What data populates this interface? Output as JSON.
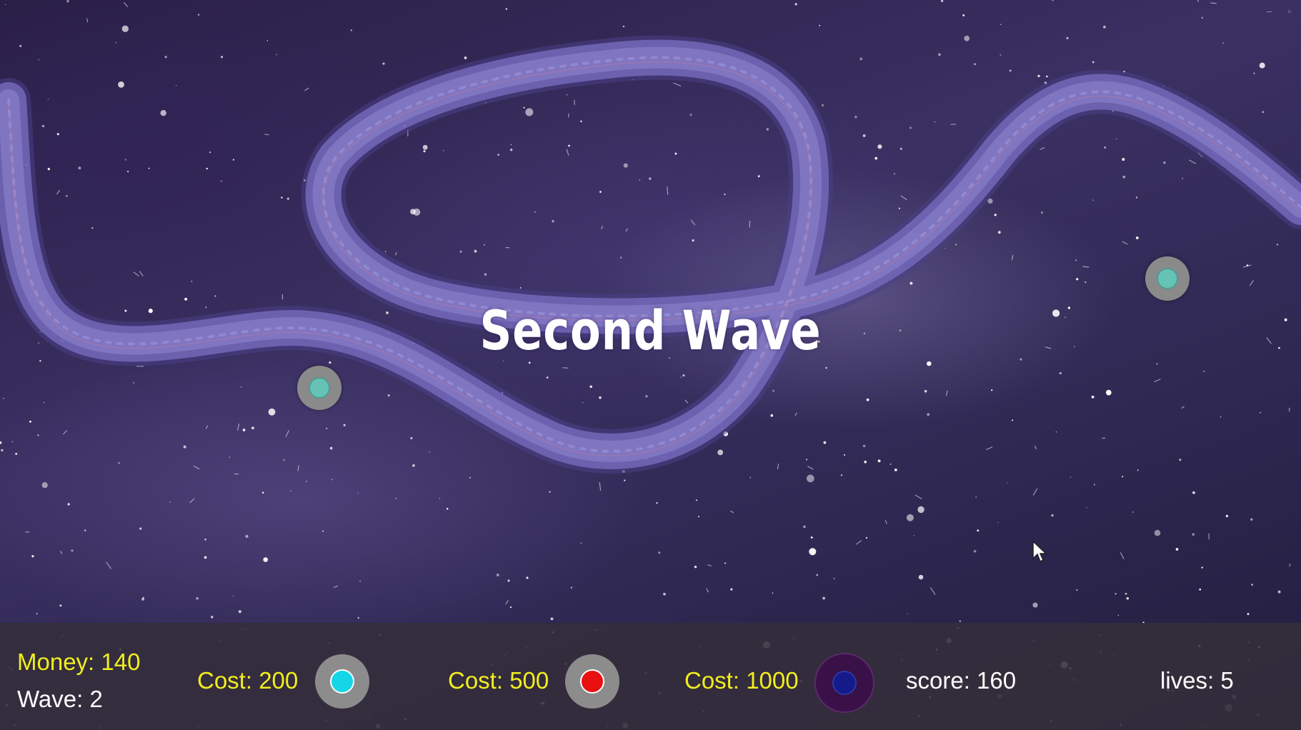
{
  "colors": {
    "hud_money_text": "#f2ee1e",
    "hud_white_text": "#ffffff",
    "tower_base": "#8a8a8a",
    "tower1_core": "#14d6e6",
    "tower2_core": "#e81010",
    "tower3_base": "#3a1048",
    "tower3_core": "#151a8a",
    "placed_tower_core": "#67c2b6",
    "track": "#6d63b0"
  },
  "banner": {
    "text": "Second Wave"
  },
  "placed_towers": [
    {
      "type": "cyan-tower"
    },
    {
      "type": "cyan-tower"
    }
  ],
  "hud": {
    "money_label": "Money: 140",
    "wave_label": "Wave:  2",
    "shop": [
      {
        "cost_label": "Cost: 200",
        "icon": "cyan-tower-icon"
      },
      {
        "cost_label": "Cost: 500",
        "icon": "red-tower-icon"
      },
      {
        "cost_label": "Cost: 1000",
        "icon": "blue-tower-icon"
      }
    ],
    "score_label": "score: 160",
    "lives_label": "lives: 5"
  },
  "window_controls": {
    "minimize": "–",
    "maximize": "▫"
  }
}
